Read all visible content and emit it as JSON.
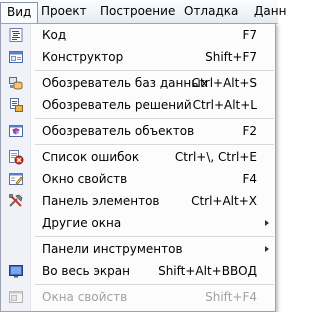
{
  "menubar": {
    "items": [
      "Вид",
      "Проект",
      "Построение",
      "Отладка",
      "Данн"
    ]
  },
  "menu": {
    "items": [
      {
        "label": "Код",
        "shortcut": "F7",
        "icon": "code-icon"
      },
      {
        "label": "Конструктор",
        "shortcut": "Shift+F7",
        "icon": "designer-icon"
      },
      {
        "label": "Обозреватель баз данных",
        "shortcut": "Ctrl+Alt+S",
        "icon": "database-explorer-icon"
      },
      {
        "label": "Обозреватель решений",
        "shortcut": "Ctrl+Alt+L",
        "icon": "solution-explorer-icon"
      },
      {
        "label": "Обозреватель объектов",
        "shortcut": "F2",
        "icon": "object-browser-icon"
      },
      {
        "label": "Список ошибок",
        "shortcut": "Ctrl+\\, Ctrl+E",
        "icon": "error-list-icon"
      },
      {
        "label": "Окно свойств",
        "shortcut": "F4",
        "icon": "properties-window-icon"
      },
      {
        "label": "Панель элементов",
        "shortcut": "Ctrl+Alt+X",
        "icon": "toolbox-icon"
      },
      {
        "label": "Другие окна",
        "shortcut": "",
        "icon": ""
      },
      {
        "label": "Панели инструментов",
        "shortcut": "",
        "icon": ""
      },
      {
        "label": "Во весь экран",
        "shortcut": "Shift+Alt+ВВОД",
        "icon": "full-screen-icon"
      },
      {
        "label": "Окна свойств",
        "shortcut": "Shift+F4",
        "icon": "property-pages-icon"
      }
    ]
  },
  "colors": {
    "menu_background": "#fcfcfc",
    "gutter": "#f1f2f7",
    "disabled_text": "#a1a1a1"
  }
}
